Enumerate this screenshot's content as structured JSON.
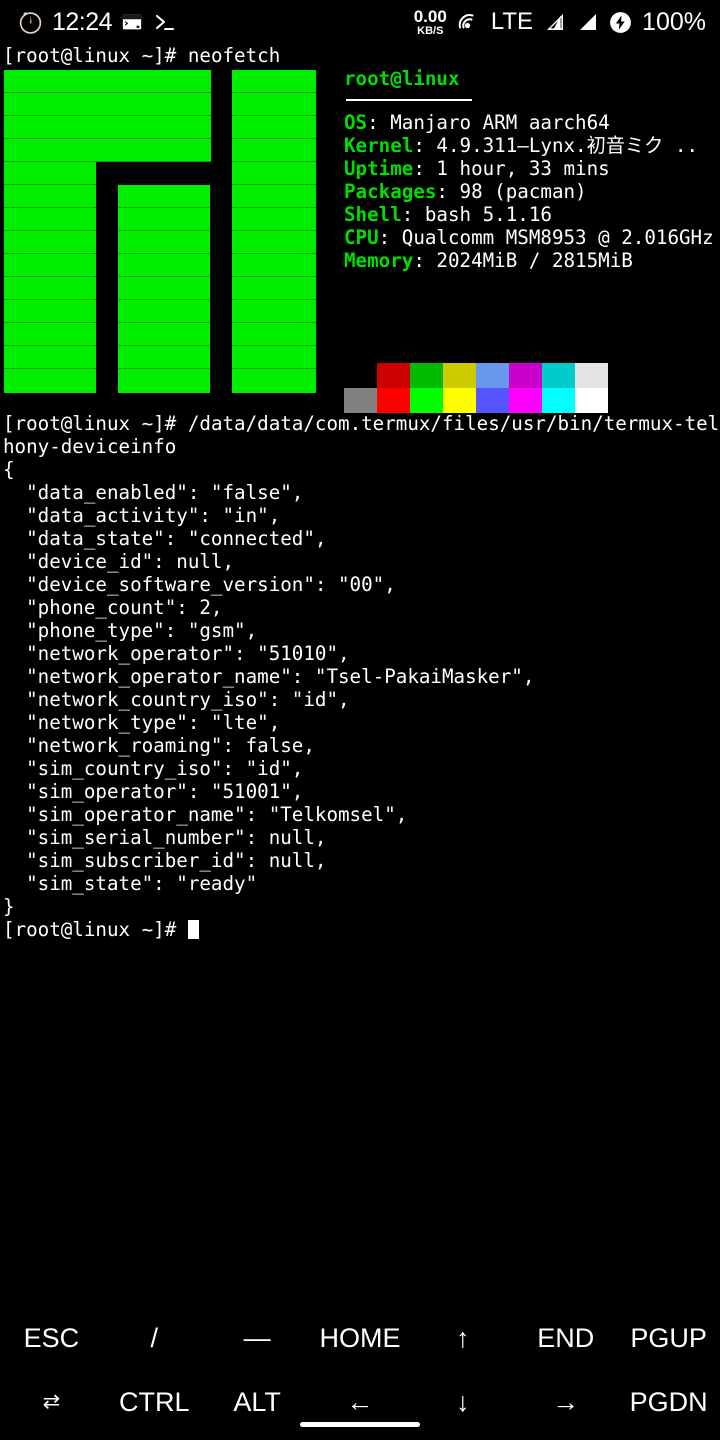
{
  "status_bar": {
    "time": "12:24",
    "alarm_icon": "alarm-clock-icon",
    "terminal_window_icon": "terminal-window-icon",
    "prompt_icon": "command-prompt-icon",
    "net_speed_value": "0.00",
    "net_speed_unit": "KB/S",
    "hotspot_icon": "hotspot-icon",
    "network_type": "LTE",
    "signal_icon_1": "signal-bars-icon",
    "signal_icon_2": "signal-bars-icon",
    "battery_icon": "battery-charging-icon",
    "battery_percent": "100%"
  },
  "terminal": {
    "prompt": "[root@linux ~]# ",
    "command_1": "neofetch",
    "command_2_line1": "/data/data/com.termux/files/usr/bin/termux-telep",
    "command_2_line2": "hony-deviceinfo",
    "final_prompt": "[root@linux ~]# ",
    "json_output": [
      "{",
      "  \"data_enabled\": \"false\",",
      "  \"data_activity\": \"in\",",
      "  \"data_state\": \"connected\",",
      "  \"device_id\": null,",
      "  \"device_software_version\": \"00\",",
      "  \"phone_count\": 2,",
      "  \"phone_type\": \"gsm\",",
      "  \"network_operator\": \"51010\",",
      "  \"network_operator_name\": \"Tsel-PakaiMasker\",",
      "  \"network_country_iso\": \"id\",",
      "  \"network_type\": \"lte\",",
      "  \"network_roaming\": false,",
      "  \"sim_country_iso\": \"id\",",
      "  \"sim_operator\": \"51001\",",
      "  \"sim_operator_name\": \"Telkomsel\",",
      "  \"sim_serial_number\": null,",
      "  \"sim_subscriber_id\": null,",
      "  \"sim_state\": \"ready\"",
      "}"
    ]
  },
  "neofetch": {
    "user": "root",
    "at": "@",
    "host": "linux",
    "entries": [
      {
        "key": "OS",
        "value": "Manjaro ARM aarch64"
      },
      {
        "key": "Kernel",
        "value": "4.9.311—Lynx.初音ミク .."
      },
      {
        "key": "Uptime",
        "value": "1 hour, 33 mins"
      },
      {
        "key": "Packages",
        "value": "98 (pacman)"
      },
      {
        "key": "Shell",
        "value": "bash 5.1.16"
      },
      {
        "key": "CPU",
        "value": "Qualcomm MSM8953 @ 2.016GHz"
      },
      {
        "key": "Memory",
        "value": "2024MiB / 2815MiB"
      }
    ],
    "palette_row_dim": [
      "#000000",
      "#cc0000",
      "#00bb00",
      "#cccc00",
      "#6699ee",
      "#cc00cc",
      "#00cccc",
      "#e4e4e4"
    ],
    "palette_row_bright": [
      "#808080",
      "#ff0000",
      "#00ff00",
      "#ffff00",
      "#5555ff",
      "#ff00ff",
      "#00ffff",
      "#ffffff"
    ],
    "ascii_art_color": "#00ee00"
  },
  "extra_keys": {
    "row1": [
      "ESC",
      "/",
      "—",
      "HOME",
      "↑",
      "END",
      "PGUP"
    ],
    "row2": [
      "⇄",
      "CTRL",
      "ALT",
      "←",
      "↓",
      "→",
      "PGDN"
    ]
  }
}
